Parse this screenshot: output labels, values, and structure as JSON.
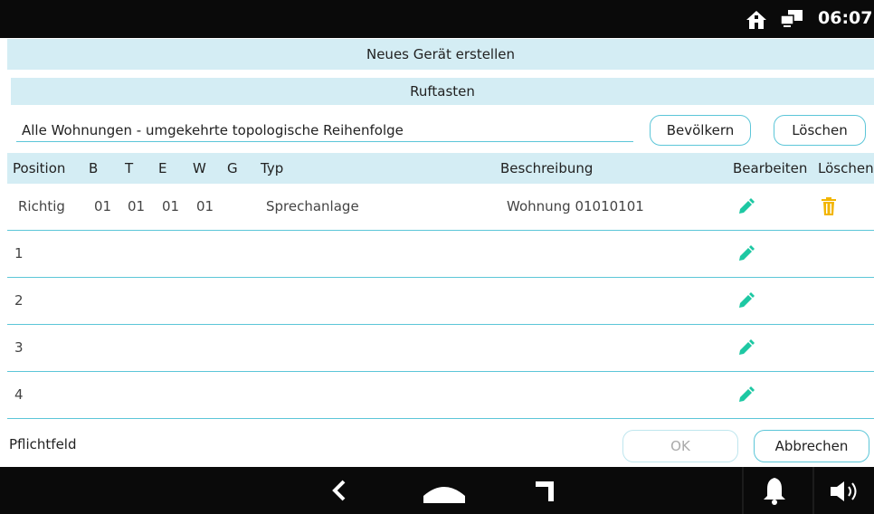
{
  "status_bar": {
    "time": "06:07",
    "icons": [
      "home-icon",
      "network-icon"
    ]
  },
  "title": "Neues Gerät erstellen",
  "section": "Ruftasten",
  "filter": {
    "value": "Alle Wohnungen - umgekehrte topologische Reihenfolge"
  },
  "buttons": {
    "populate": "Bevölkern",
    "clear": "Löschen",
    "ok": "OK",
    "cancel": "Abbrechen"
  },
  "table": {
    "columns": [
      "Position",
      "B",
      "T",
      "E",
      "W",
      "G",
      "Typ",
      "Beschreibung",
      "Bearbeiten",
      "Löschen"
    ],
    "rows": [
      {
        "position": "Richtig",
        "b": "01",
        "t": "01",
        "e": "01",
        "w": "01",
        "g": "",
        "typ": "Sprechanlage",
        "beschreibung": "Wohnung 01010101",
        "edit": "pencil-icon",
        "delete": "trash-icon"
      },
      {
        "position": "1",
        "b": "",
        "t": "",
        "e": "",
        "w": "",
        "g": "",
        "typ": "",
        "beschreibung": "",
        "edit": "pencil-icon",
        "delete": ""
      },
      {
        "position": "2",
        "b": "",
        "t": "",
        "e": "",
        "w": "",
        "g": "",
        "typ": "",
        "beschreibung": "",
        "edit": "pencil-icon",
        "delete": ""
      },
      {
        "position": "3",
        "b": "",
        "t": "",
        "e": "",
        "w": "",
        "g": "",
        "typ": "",
        "beschreibung": "",
        "edit": "pencil-icon",
        "delete": ""
      },
      {
        "position": "4",
        "b": "",
        "t": "",
        "e": "",
        "w": "",
        "g": "",
        "typ": "",
        "beschreibung": "",
        "edit": "pencil-icon",
        "delete": ""
      }
    ]
  },
  "footer": {
    "required_label": "Pflichtfeld"
  },
  "nav_bar": {
    "icons": [
      "back-icon",
      "home-icon",
      "recent-apps-icon",
      "bell-icon",
      "volume-icon"
    ]
  },
  "colors": {
    "accent": "#5cc6d8",
    "header_bg": "#d4edf4",
    "edit_icon": "#1dc8a3",
    "delete_icon": "#f2b500",
    "bar_bg": "#0a0a0a"
  }
}
